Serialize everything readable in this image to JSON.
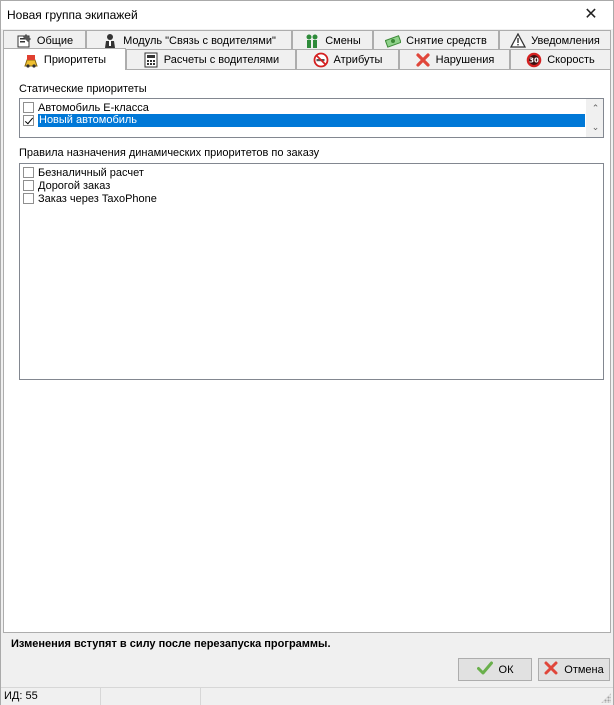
{
  "window": {
    "title": "Новая группа экипажей",
    "close_glyph": "✕"
  },
  "tabs_row1": [
    {
      "label": "Общие",
      "icon": "form-icon"
    },
    {
      "label": "Модуль \"Связь с водителями\"",
      "icon": "driver-icon"
    },
    {
      "label": "Смены",
      "icon": "people-icon"
    },
    {
      "label": "Снятие средств",
      "icon": "money-icon"
    },
    {
      "label": "Уведомления",
      "icon": "warning-icon"
    }
  ],
  "tabs_row2": [
    {
      "label": "Приоритеты",
      "icon": "priority-icon",
      "active": true
    },
    {
      "label": "Расчеты с водителями",
      "icon": "calculator-icon"
    },
    {
      "label": "Атрибуты",
      "icon": "no-smoking-icon"
    },
    {
      "label": "Нарушения",
      "icon": "red-x-icon"
    },
    {
      "label": "Скорость",
      "icon": "speed-limit-icon",
      "speed_text": "30"
    }
  ],
  "static_priorities": {
    "label": "Статические приоритеты",
    "items": [
      {
        "label": "Автомобиль E-класса",
        "checked": false,
        "selected": false
      },
      {
        "label": "Новый автомобиль",
        "checked": true,
        "selected": true
      }
    ],
    "scroll_up": "⌃",
    "scroll_down": "⌄"
  },
  "dynamic_rules": {
    "label": "Правила назначения динамических приоритетов по заказу",
    "items": [
      {
        "label": "Безналичный расчет",
        "checked": false
      },
      {
        "label": "Дорогой заказ",
        "checked": false
      },
      {
        "label": "Заказ через TaxoPhone",
        "checked": false
      }
    ]
  },
  "notice": "Изменения вступят в силу после перезапуска программы.",
  "buttons": {
    "ok": "ОК",
    "cancel": "Отмена"
  },
  "status": {
    "id_text": "ИД: 55"
  },
  "colors": {
    "selection": "#0078d7",
    "ok_check": "#6ab04c",
    "cancel_x": "#e0463a"
  }
}
